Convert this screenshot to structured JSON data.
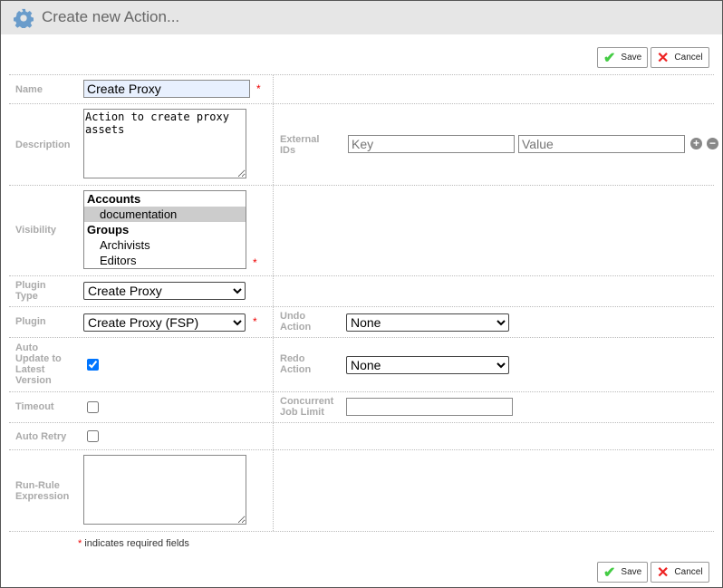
{
  "header": {
    "title": "Create new Action..."
  },
  "buttons": {
    "save": "Save",
    "cancel": "Cancel"
  },
  "fields": {
    "name": {
      "label": "Name",
      "value": "Create Proxy"
    },
    "description": {
      "label": "Description",
      "value": "Action to create proxy assets"
    },
    "external_ids": {
      "label": "External IDs",
      "key_placeholder": "Key",
      "value_placeholder": "Value"
    },
    "visibility": {
      "label": "Visibility",
      "options": [
        {
          "text": "Accounts",
          "group": true
        },
        {
          "text": "documentation",
          "selected": true
        },
        {
          "text": "Groups",
          "group": true
        },
        {
          "text": "Archivists"
        },
        {
          "text": "Editors"
        }
      ]
    },
    "plugin_type": {
      "label": "Plugin Type",
      "value": "Create Proxy"
    },
    "plugin": {
      "label": "Plugin",
      "value": "Create Proxy (FSP)"
    },
    "undo_action": {
      "label": "Undo Action",
      "value": "None"
    },
    "auto_update": {
      "label": "Auto Update to Latest Version",
      "checked": true
    },
    "redo_action": {
      "label": "Redo Action",
      "value": "None"
    },
    "timeout": {
      "label": "Timeout",
      "checked": false
    },
    "concurrent": {
      "label": "Concurrent Job Limit",
      "value": ""
    },
    "auto_retry": {
      "label": "Auto Retry",
      "checked": false
    },
    "run_rule": {
      "label": "Run-Rule Expression",
      "value": ""
    }
  },
  "required_note": {
    "star": "*",
    "text": "indicates required fields"
  }
}
